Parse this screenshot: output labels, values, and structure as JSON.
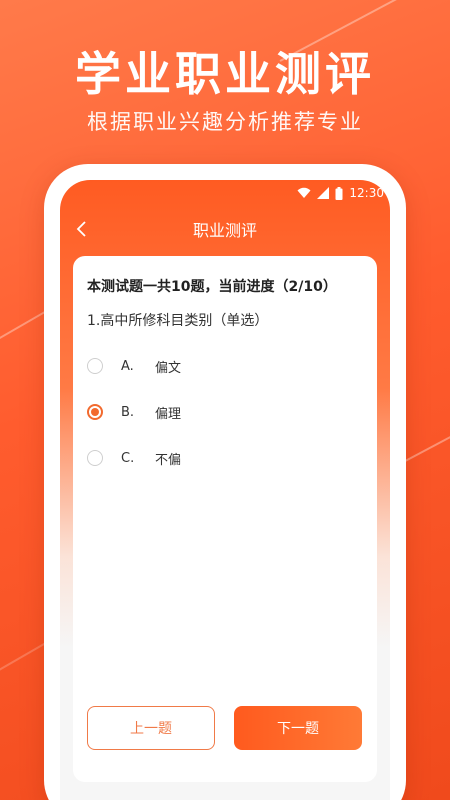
{
  "promo": {
    "title": "学业职业测评",
    "subtitle": "根据职业兴趣分析推荐专业"
  },
  "status_bar": {
    "time": "12:30",
    "icons": [
      "wifi-icon",
      "cellular-signal-icon",
      "battery-icon"
    ]
  },
  "nav": {
    "title": "职业测评",
    "back_icon": "chevron-left-icon"
  },
  "quiz": {
    "progress_text": "本测试题一共10题，当前进度（2/10）",
    "question": "1.高中所修科目类别（单选）",
    "options": [
      {
        "letter": "A.",
        "text": "偏文",
        "selected": false
      },
      {
        "letter": "B.",
        "text": "偏理",
        "selected": true
      },
      {
        "letter": "C.",
        "text": "不偏",
        "selected": false
      }
    ]
  },
  "buttons": {
    "prev_label": "上一题",
    "next_label": "下一题"
  },
  "colors": {
    "accent": "#ff5c2e",
    "selected_radio": "#f26a2e"
  }
}
